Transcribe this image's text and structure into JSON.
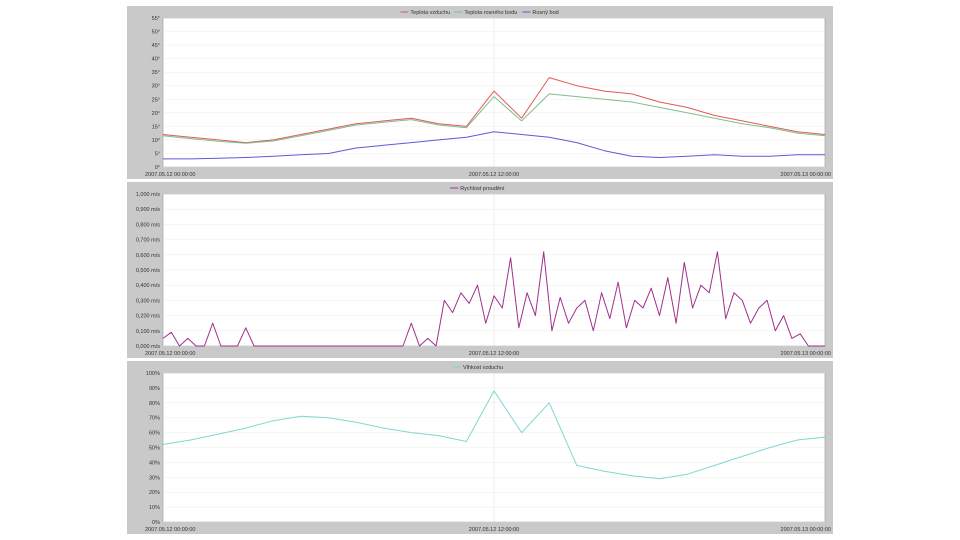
{
  "chart_data": [
    {
      "type": "line",
      "title": "",
      "legend_placement": "top",
      "grid": true,
      "ylim": [
        0,
        55
      ],
      "y_ticks": [
        "0°",
        "5°",
        "10°",
        "15°",
        "20°",
        "25°",
        "30°",
        "35°",
        "40°",
        "45°",
        "50°",
        "55°"
      ],
      "x_tick_labels": [
        "2007.05.12 00:00:00",
        "2007.05.12 12:00:00",
        "2007.05.13 00:00:00"
      ],
      "x": [
        0,
        1,
        2,
        3,
        4,
        5,
        6,
        7,
        8,
        9,
        10,
        11,
        12,
        13,
        14,
        15,
        16,
        17,
        18,
        19,
        20,
        21,
        22,
        23,
        24
      ],
      "series": [
        {
          "name": "Teplota vzduchu",
          "color": "#e05a5a",
          "values": [
            12,
            11,
            10,
            9,
            10,
            12,
            14,
            16,
            17,
            18,
            16,
            15,
            28,
            18,
            33,
            30,
            28,
            27,
            24,
            22,
            19,
            17,
            15,
            13,
            12
          ]
        },
        {
          "name": "Teplota rosného bodu",
          "color": "#7fbf8f",
          "values": [
            11.5,
            10.5,
            9.5,
            8.8,
            9.6,
            11.5,
            13.5,
            15.5,
            16.5,
            17.5,
            15.5,
            14.5,
            26,
            17,
            27,
            26,
            25,
            24,
            22,
            20,
            18,
            16,
            14.5,
            12.5,
            11.5
          ]
        },
        {
          "name": "Rosný bod",
          "color": "#5b5bd6",
          "values": [
            3,
            3,
            3.2,
            3.5,
            4,
            4.5,
            5,
            7,
            8,
            9,
            10,
            11,
            13,
            12,
            11,
            9,
            6,
            4,
            3.5,
            4,
            4.5,
            4,
            4,
            4.5,
            4.5
          ]
        }
      ]
    },
    {
      "type": "line",
      "title": "",
      "legend_placement": "top",
      "grid": true,
      "ylim": [
        0,
        1
      ],
      "y_ticks": [
        "0,000 m/s",
        "0,100 m/s",
        "0,200 m/s",
        "0,300 m/s",
        "0,400 m/s",
        "0,500 m/s",
        "0,600 m/s",
        "0,700 m/s",
        "0,800 m/s",
        "0,900 m/s",
        "1,000 m/s"
      ],
      "x_tick_labels": [
        "2007.05.12 00:00:00",
        "2007.05.12 12:00:00",
        "2007.05.13 00:00:00"
      ],
      "x": [
        0,
        0.3,
        0.6,
        0.9,
        1.2,
        1.5,
        1.8,
        2.1,
        2.4,
        2.7,
        3.0,
        3.3,
        3.6,
        3.9,
        4.2,
        4.5,
        4.8,
        5.1,
        5.4,
        5.7,
        6.0,
        6.3,
        6.6,
        6.9,
        7.2,
        7.5,
        7.8,
        8.1,
        8.4,
        8.7,
        9.0,
        9.3,
        9.6,
        9.9,
        10.2,
        10.5,
        10.8,
        11.1,
        11.4,
        11.7,
        12.0,
        12.3,
        12.6,
        12.9,
        13.2,
        13.5,
        13.8,
        14.1,
        14.4,
        14.7,
        15.0,
        15.3,
        15.6,
        15.9,
        16.2,
        16.5,
        16.8,
        17.1,
        17.4,
        17.7,
        18.0,
        18.3,
        18.6,
        18.9,
        19.2,
        19.5,
        19.8,
        20.1,
        20.4,
        20.7,
        21.0,
        21.3,
        21.6,
        21.9,
        22.2,
        22.5,
        22.8,
        23.1,
        23.4,
        23.7,
        24.0
      ],
      "series": [
        {
          "name": "Rychlost proudění",
          "color": "#a0308c",
          "values": [
            0.05,
            0.09,
            0,
            0.05,
            0,
            0,
            0.15,
            0,
            0,
            0,
            0.12,
            0,
            0,
            0,
            0,
            0,
            0,
            0,
            0,
            0,
            0,
            0,
            0,
            0,
            0,
            0,
            0,
            0,
            0,
            0,
            0.15,
            0,
            0.05,
            0,
            0.3,
            0.22,
            0.35,
            0.28,
            0.4,
            0.15,
            0.33,
            0.25,
            0.58,
            0.12,
            0.35,
            0.2,
            0.62,
            0.1,
            0.32,
            0.15,
            0.25,
            0.3,
            0.1,
            0.35,
            0.18,
            0.42,
            0.12,
            0.3,
            0.25,
            0.38,
            0.2,
            0.45,
            0.15,
            0.55,
            0.25,
            0.4,
            0.35,
            0.62,
            0.18,
            0.35,
            0.3,
            0.15,
            0.25,
            0.3,
            0.1,
            0.2,
            0.05,
            0.08,
            0,
            0,
            0
          ]
        }
      ]
    },
    {
      "type": "line",
      "title": "",
      "legend_placement": "top",
      "grid": true,
      "ylim": [
        0,
        100
      ],
      "y_ticks": [
        "0%",
        "10%",
        "20%",
        "30%",
        "40%",
        "50%",
        "60%",
        "70%",
        "80%",
        "90%",
        "100%"
      ],
      "x_tick_labels": [
        "2007.05.12 00:00:00",
        "2007.05.12 12:00:00",
        "2007.05.13 00:00:00"
      ],
      "x": [
        0,
        1,
        2,
        3,
        4,
        5,
        6,
        7,
        8,
        9,
        10,
        11,
        12,
        13,
        14,
        15,
        16,
        17,
        18,
        19,
        20,
        21,
        22,
        23,
        24
      ],
      "series": [
        {
          "name": "Vlhkost vzduchu",
          "color": "#7fd8cf",
          "values": [
            52,
            55,
            59,
            63,
            68,
            71,
            70,
            67,
            63,
            60,
            58,
            54,
            88,
            60,
            80,
            38,
            34,
            31,
            29,
            32,
            38,
            44,
            50,
            55,
            57
          ]
        }
      ]
    }
  ]
}
